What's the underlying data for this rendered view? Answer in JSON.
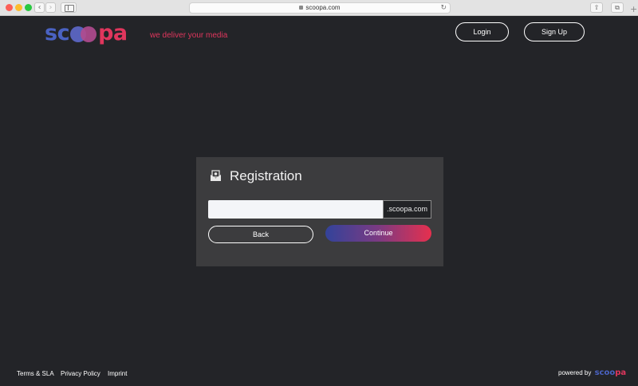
{
  "browser": {
    "url": "scoopa.com",
    "back_glyph": "‹",
    "forward_glyph": "›",
    "reload_glyph": "↻",
    "share_glyph": "⇧",
    "tabs_glyph": "⧉",
    "new_tab_glyph": "+"
  },
  "header": {
    "logo": {
      "part1": "sc",
      "part2": "pa"
    },
    "tagline": "we deliver your media",
    "login_label": "Login",
    "signup_label": "Sign Up"
  },
  "registration": {
    "title": "Registration",
    "subdomain_value": "",
    "domain_suffix": ".scoopa.com",
    "back_label": "Back",
    "continue_label": "Continue"
  },
  "footer": {
    "links": [
      "Terms & SLA",
      "Privacy Policy",
      "Imprint"
    ],
    "powered_by": "powered by",
    "powered_logo": {
      "part1": "sc",
      "part2": "pa"
    }
  },
  "colors": {
    "background": "#232428",
    "card": "#3c3c3e",
    "brand_blue": "#4a62c2",
    "brand_pink": "#e0365d",
    "gradient_start": "#33439a",
    "gradient_end": "#e6304e"
  }
}
